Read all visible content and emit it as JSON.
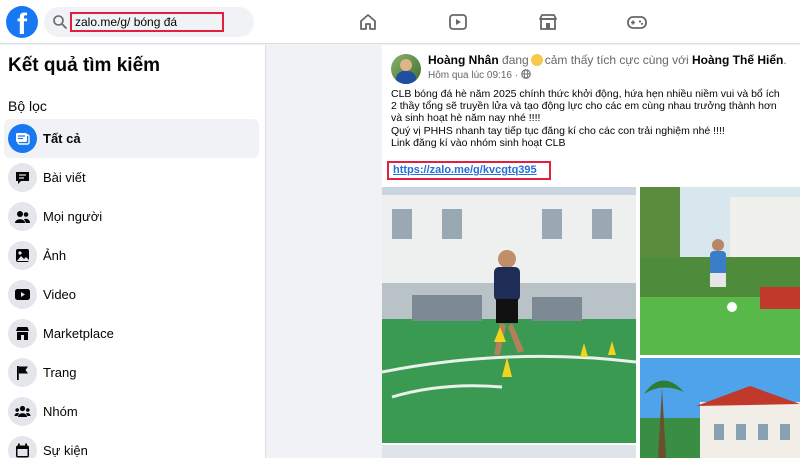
{
  "header": {
    "search_value": "zalo.me/g/ bóng đá",
    "nav_icons": [
      "home-icon",
      "video-icon",
      "marketplace-icon",
      "gaming-icon"
    ]
  },
  "sidebar": {
    "title": "Kết quả tìm kiếm",
    "filter_label": "Bộ lọc",
    "items": [
      {
        "label": "Tất cả",
        "icon": "all-results-icon",
        "active": true
      },
      {
        "label": "Bài viết",
        "icon": "posts-icon"
      },
      {
        "label": "Mọi người",
        "icon": "people-icon"
      },
      {
        "label": "Ảnh",
        "icon": "photos-icon"
      },
      {
        "label": "Video",
        "icon": "video-icon"
      },
      {
        "label": "Marketplace",
        "icon": "marketplace-icon"
      },
      {
        "label": "Trang",
        "icon": "flag-icon"
      },
      {
        "label": "Nhóm",
        "icon": "groups-icon"
      },
      {
        "label": "Sự kiện",
        "icon": "events-icon"
      }
    ]
  },
  "post": {
    "author": "Hoàng Nhân",
    "status_verb": "đang",
    "feeling": "cảm thấy tích cực cùng với",
    "tagged": "Hoàng Thế Hiển",
    "time": "Hôm qua lúc 09:16 ·",
    "lines": [
      "CLB bóng đá hè năm 2025 chính thức khởi động, hứa hẹn nhiều niềm vui và bổ ích",
      "2 thầy tổng sẽ truyền lửa và tạo động lực cho các em cùng nhau trưởng thành hơn",
      "và sinh hoạt hè năm nay nhé !!!!",
      "Quý vị PHHS nhanh tay tiếp tục đăng kí cho các con trải nghiệm nhé !!!!",
      "Link đăng kí vào nhóm sinh hoạt CLB"
    ],
    "link": "https://zalo.me/g/kvcgtq395"
  },
  "colors": {
    "brand": "#1877f2",
    "highlight": "#e41e3f",
    "link": "#216fdb"
  }
}
